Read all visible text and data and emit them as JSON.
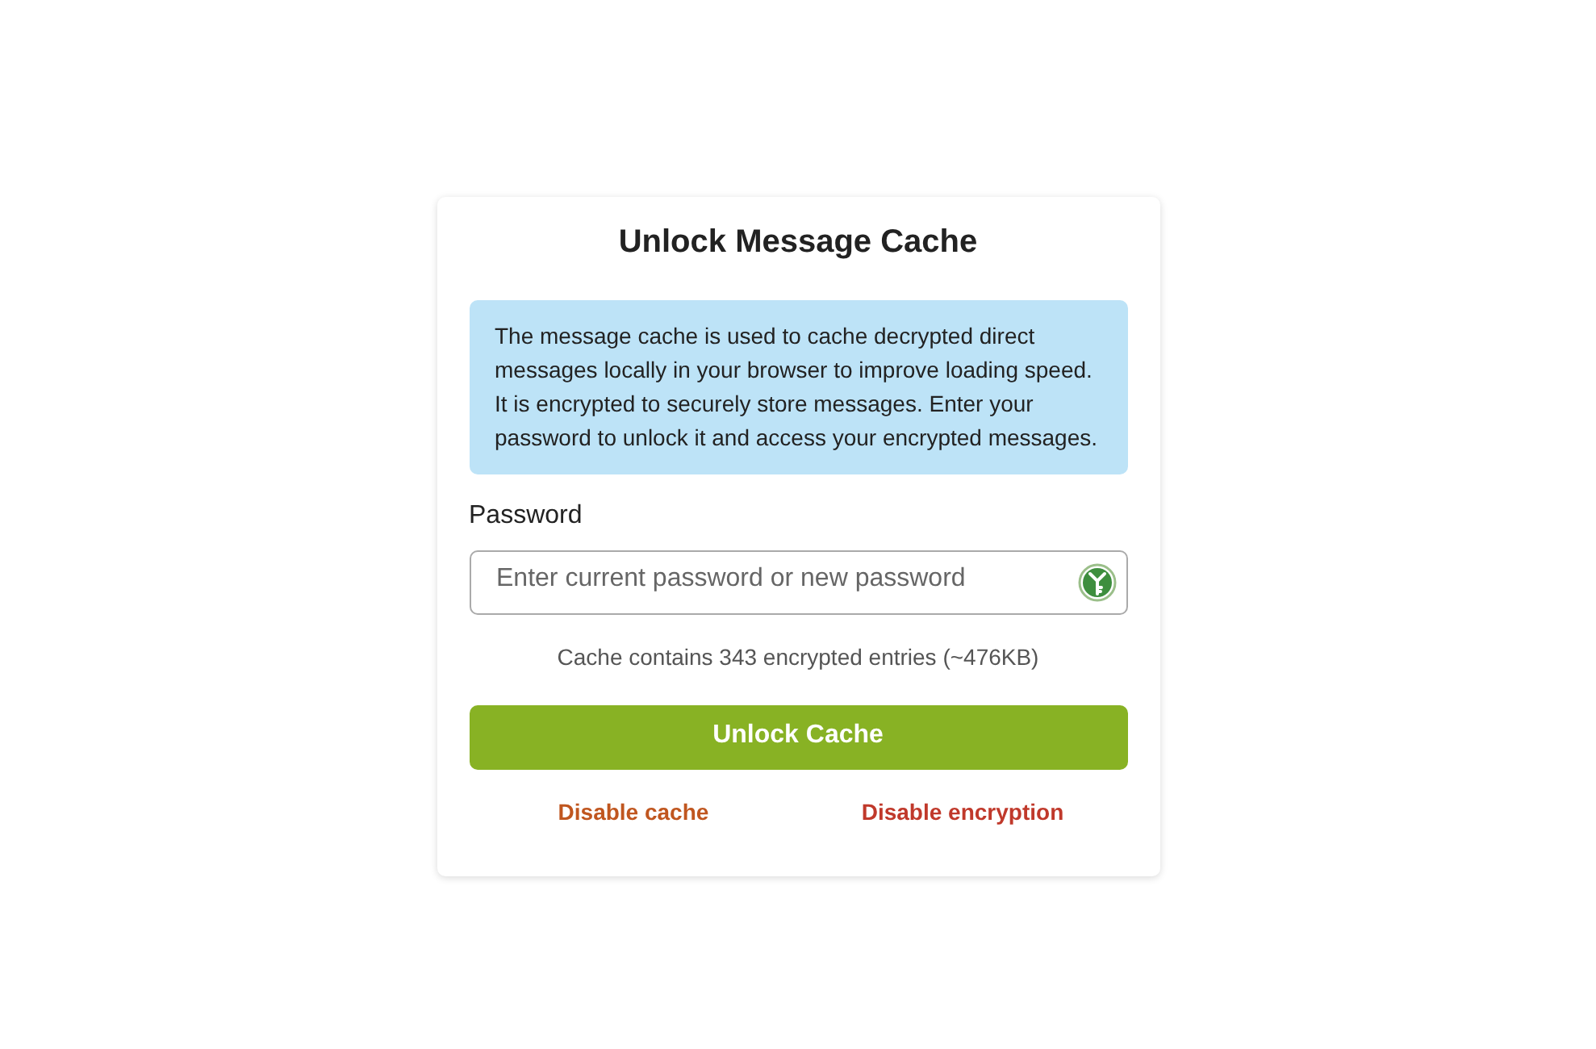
{
  "dialog": {
    "title": "Unlock Message Cache",
    "info": "The message cache is used to cache decrypted direct messages locally in your browser to improve loading speed. It is encrypted to securely store messages. Enter your password to unlock it and access your encrypted messages.",
    "password": {
      "label": "Password",
      "placeholder": "Enter current password or new password"
    },
    "cache_info": "Cache contains 343 encrypted entries (~476KB)",
    "unlock_button": "Unlock Cache",
    "links": [
      {
        "label": "Disable cache",
        "color": "#c0561f"
      },
      {
        "label": "Disable encryption",
        "color": "#c0392b"
      }
    ]
  }
}
